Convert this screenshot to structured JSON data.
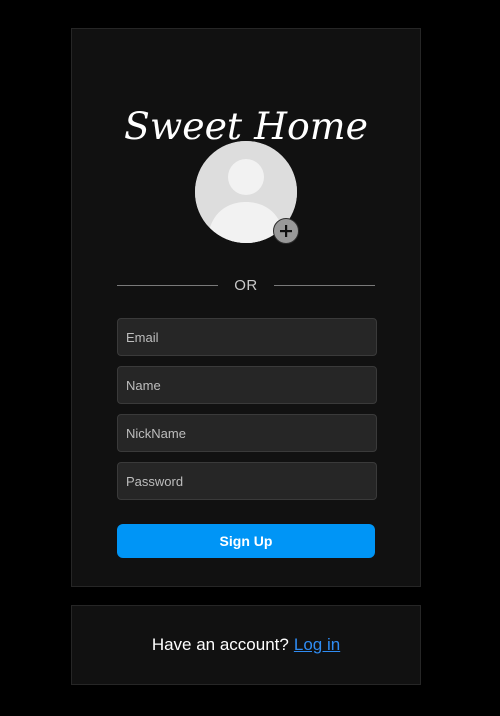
{
  "brand": {
    "logo_text": "Sweet Home"
  },
  "avatar": {
    "add_icon": "plus-icon"
  },
  "divider": {
    "text": "OR"
  },
  "form": {
    "email_placeholder": "Email",
    "name_placeholder": "Name",
    "nickname_placeholder": "NickName",
    "password_placeholder": "Password",
    "signup_label": "Sign Up"
  },
  "login": {
    "prompt": "Have an account?",
    "link_label": "Log in"
  },
  "colors": {
    "background": "#000000",
    "card": "#111111",
    "input": "#262626",
    "primary": "#0095f6",
    "link": "#2f8cf3"
  }
}
